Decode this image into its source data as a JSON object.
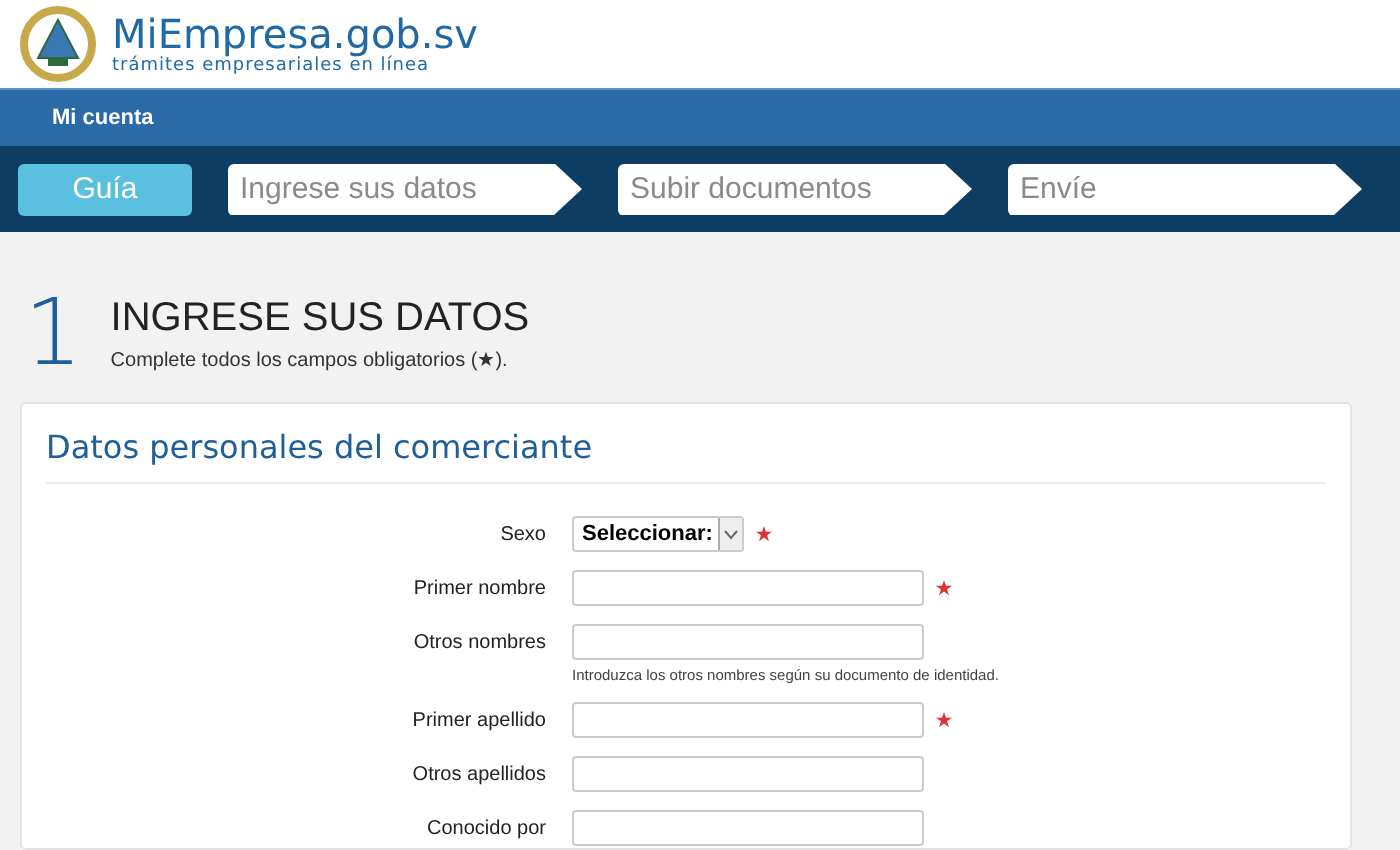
{
  "header": {
    "site_name": "MiEmpresa.gob.sv",
    "tagline": "trámites empresariales en línea"
  },
  "top_nav": {
    "items": [
      "Mi cuenta"
    ]
  },
  "steps": [
    {
      "label": "Guía",
      "selected": true
    },
    {
      "label": "Ingrese sus datos",
      "selected": false
    },
    {
      "label": "Subir documentos",
      "selected": false
    },
    {
      "label": "Envíe",
      "selected": false
    }
  ],
  "page_heading": {
    "number": "1",
    "title": "INGRESE SUS DATOS",
    "subtitle": "Complete todos los campos obligatorios (★)."
  },
  "section": {
    "title": "Datos personales del comerciante",
    "fields": [
      {
        "kind": "select",
        "label": "Sexo",
        "value": "Seleccionar:",
        "required": true
      },
      {
        "kind": "text",
        "label": "Primer nombre",
        "required": true
      },
      {
        "kind": "text",
        "label": "Otros nombres",
        "required": false,
        "hint": "Introduzca los otros nombres según su documento de identidad."
      },
      {
        "kind": "text",
        "label": "Primer apellido",
        "required": true
      },
      {
        "kind": "text",
        "label": "Otros apellidos",
        "required": false
      },
      {
        "kind": "text",
        "label": "Conocido por",
        "required": false
      }
    ]
  }
}
